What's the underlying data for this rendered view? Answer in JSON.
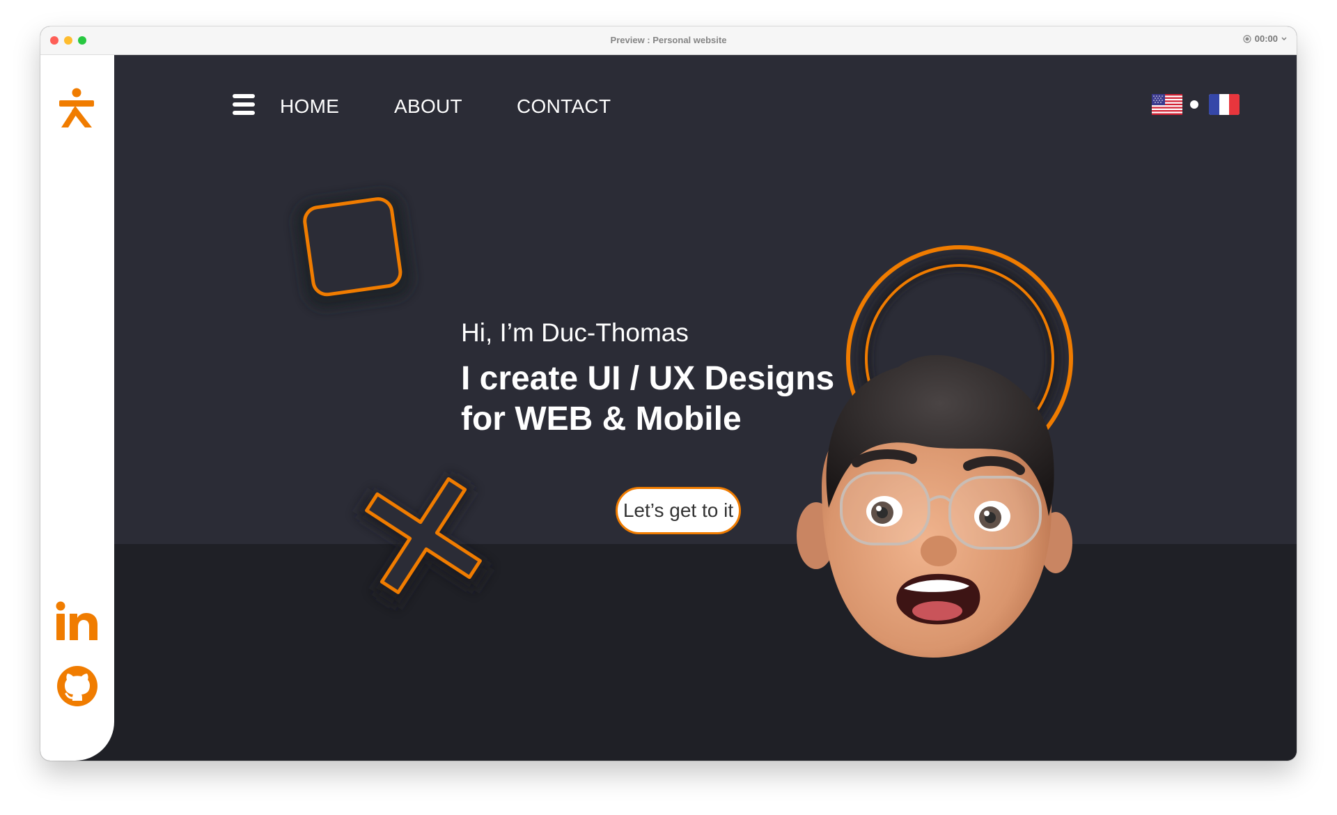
{
  "window": {
    "title": "Preview : Personal website",
    "recording_time": "00:00"
  },
  "nav": {
    "items": [
      {
        "label": "HOME"
      },
      {
        "label": "ABOUT"
      },
      {
        "label": "CONTACT"
      }
    ]
  },
  "hero": {
    "greeting": "Hi, I’m Duc-Thomas",
    "headline_line1": "I create UI / UX Designs",
    "headline_line2": "for WEB & Mobile",
    "cta_label": "Let’s get to it"
  },
  "languages": [
    {
      "icon": "us-flag-icon"
    },
    {
      "icon": "fr-flag-icon"
    }
  ],
  "sidebar": {
    "icons": [
      "logo-icon",
      "linkedin-icon",
      "github-icon"
    ]
  },
  "colors": {
    "accent": "#F07C00",
    "hero_bg": "#2B2C36",
    "lower_bg": "#1F2026",
    "sidebar_bg": "#FFFFFF"
  }
}
